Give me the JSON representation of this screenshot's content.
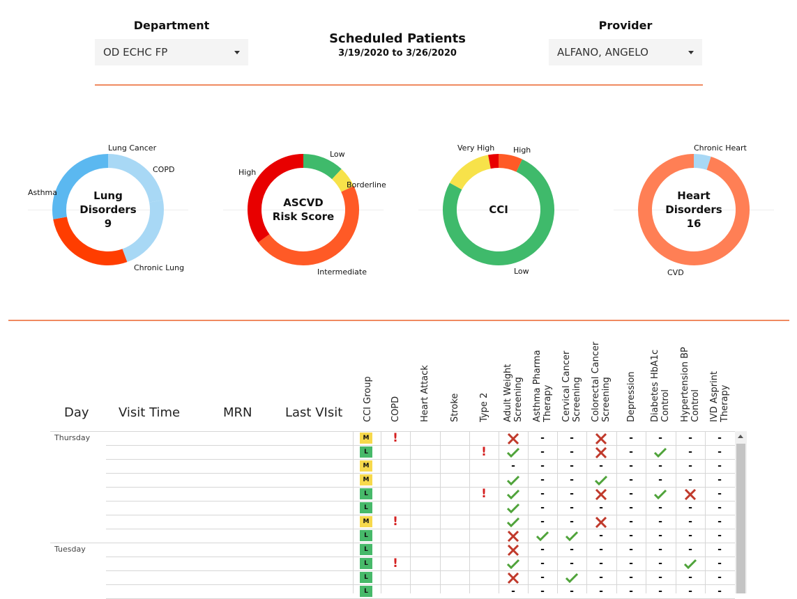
{
  "header": {
    "department_label": "Department",
    "department_value": "OD ECHC FP",
    "title": "Scheduled Patients",
    "date_range": "3/19/2020 to 3/26/2020",
    "provider_label": "Provider",
    "provider_value": "ALFANO, ANGELO",
    "accent_color": "#f08a60"
  },
  "chart_data": [
    {
      "type": "pie",
      "title": "Lung Disorders",
      "total": "9",
      "categories": [
        "Lung Cancer",
        "COPD",
        "Chronic Lung",
        "Asthma"
      ],
      "values": [
        2,
        2,
        2.5,
        2.5
      ],
      "colors": [
        "#a8d8f5",
        "#a8d8f5",
        "#ff3d00",
        "#5bb8f0"
      ]
    },
    {
      "type": "pie",
      "title": "ASCVD Risk Score",
      "categories": [
        "Low",
        "Borderline",
        "Intermediate",
        "High"
      ],
      "values": [
        12,
        6,
        47,
        35
      ],
      "colors": [
        "#3fba6b",
        "#f7e24a",
        "#ff5a26",
        "#e80000"
      ]
    },
    {
      "type": "pie",
      "title": "CCI",
      "categories": [
        "High",
        "Low",
        "Very High"
      ],
      "values": [
        7,
        76,
        14,
        3
      ],
      "labels_display": [
        "High",
        "Low",
        "Very High"
      ],
      "colors": [
        "#ff5a26",
        "#3fba6b",
        "#f7e24a",
        "#e80000"
      ]
    },
    {
      "type": "pie",
      "title": "Heart Disorders",
      "total": "16",
      "categories": [
        "Chronic Heart",
        "CVD"
      ],
      "values": [
        5,
        95
      ],
      "colors": [
        "#a8d8f5",
        "#ff7f55"
      ]
    }
  ],
  "table": {
    "columns": [
      "Day",
      "Visit Time",
      "MRN",
      "Last VIsit"
    ],
    "rotated_columns": [
      "CCI Group",
      "COPD",
      "Heart Attack",
      "Stroke",
      "Type 2",
      "Adult Weight\nScreening",
      "Asthma Pharma\nTherapy",
      "Cervical Cancer\nScreening",
      "Colorectal Cancer\nScreening",
      "Depression",
      "Diabetes HbA1c\nControl",
      "Hypertension BP\nControl",
      "IVD Asprint\nTherapy"
    ],
    "rows": [
      {
        "day": "Thursday",
        "cci": "M",
        "cells": [
          "!",
          "",
          "",
          "",
          "x",
          "-",
          "-",
          "x",
          "-",
          "-",
          "-",
          "-"
        ]
      },
      {
        "day": "",
        "cci": "L",
        "cells": [
          "",
          "",
          "",
          "!",
          "v",
          "-",
          "-",
          "x",
          "-",
          "v",
          "-",
          "-"
        ]
      },
      {
        "day": "",
        "cci": "M",
        "cells": [
          "",
          "",
          "",
          "",
          "-",
          "-",
          "-",
          "-",
          "-",
          "-",
          "-",
          "-"
        ]
      },
      {
        "day": "",
        "cci": "M",
        "cells": [
          "",
          "",
          "",
          "",
          "v",
          "-",
          "-",
          "v",
          "-",
          "-",
          "-",
          "-"
        ]
      },
      {
        "day": "",
        "cci": "L",
        "cells": [
          "",
          "",
          "",
          "!",
          "v",
          "-",
          "-",
          "x",
          "-",
          "v",
          "x",
          "-"
        ]
      },
      {
        "day": "",
        "cci": "L",
        "cells": [
          "",
          "",
          "",
          "",
          "v",
          "-",
          "-",
          "-",
          "-",
          "-",
          "-",
          "-"
        ]
      },
      {
        "day": "",
        "cci": "M",
        "cells": [
          "!",
          "",
          "",
          "",
          "v",
          "-",
          "-",
          "x",
          "-",
          "-",
          "-",
          "-"
        ]
      },
      {
        "day": "",
        "cci": "L",
        "cells": [
          "",
          "",
          "",
          "",
          "x",
          "v",
          "v",
          "-",
          "-",
          "-",
          "-",
          "-"
        ]
      },
      {
        "day": "Tuesday",
        "cci": "L",
        "cells": [
          "",
          "",
          "",
          "",
          "x",
          "-",
          "-",
          "-",
          "-",
          "-",
          "-",
          "-"
        ]
      },
      {
        "day": "",
        "cci": "L",
        "cells": [
          "!",
          "",
          "",
          "",
          "v",
          "-",
          "-",
          "-",
          "-",
          "-",
          "v",
          "-"
        ]
      },
      {
        "day": "",
        "cci": "L",
        "cells": [
          "",
          "",
          "",
          "",
          "x",
          "-",
          "v",
          "-",
          "-",
          "-",
          "-",
          "-"
        ]
      },
      {
        "day": "",
        "cci": "L",
        "cells": [
          "",
          "",
          "",
          "",
          "-",
          "-",
          "-",
          "-",
          "-",
          "-",
          "-",
          "-"
        ]
      }
    ]
  }
}
